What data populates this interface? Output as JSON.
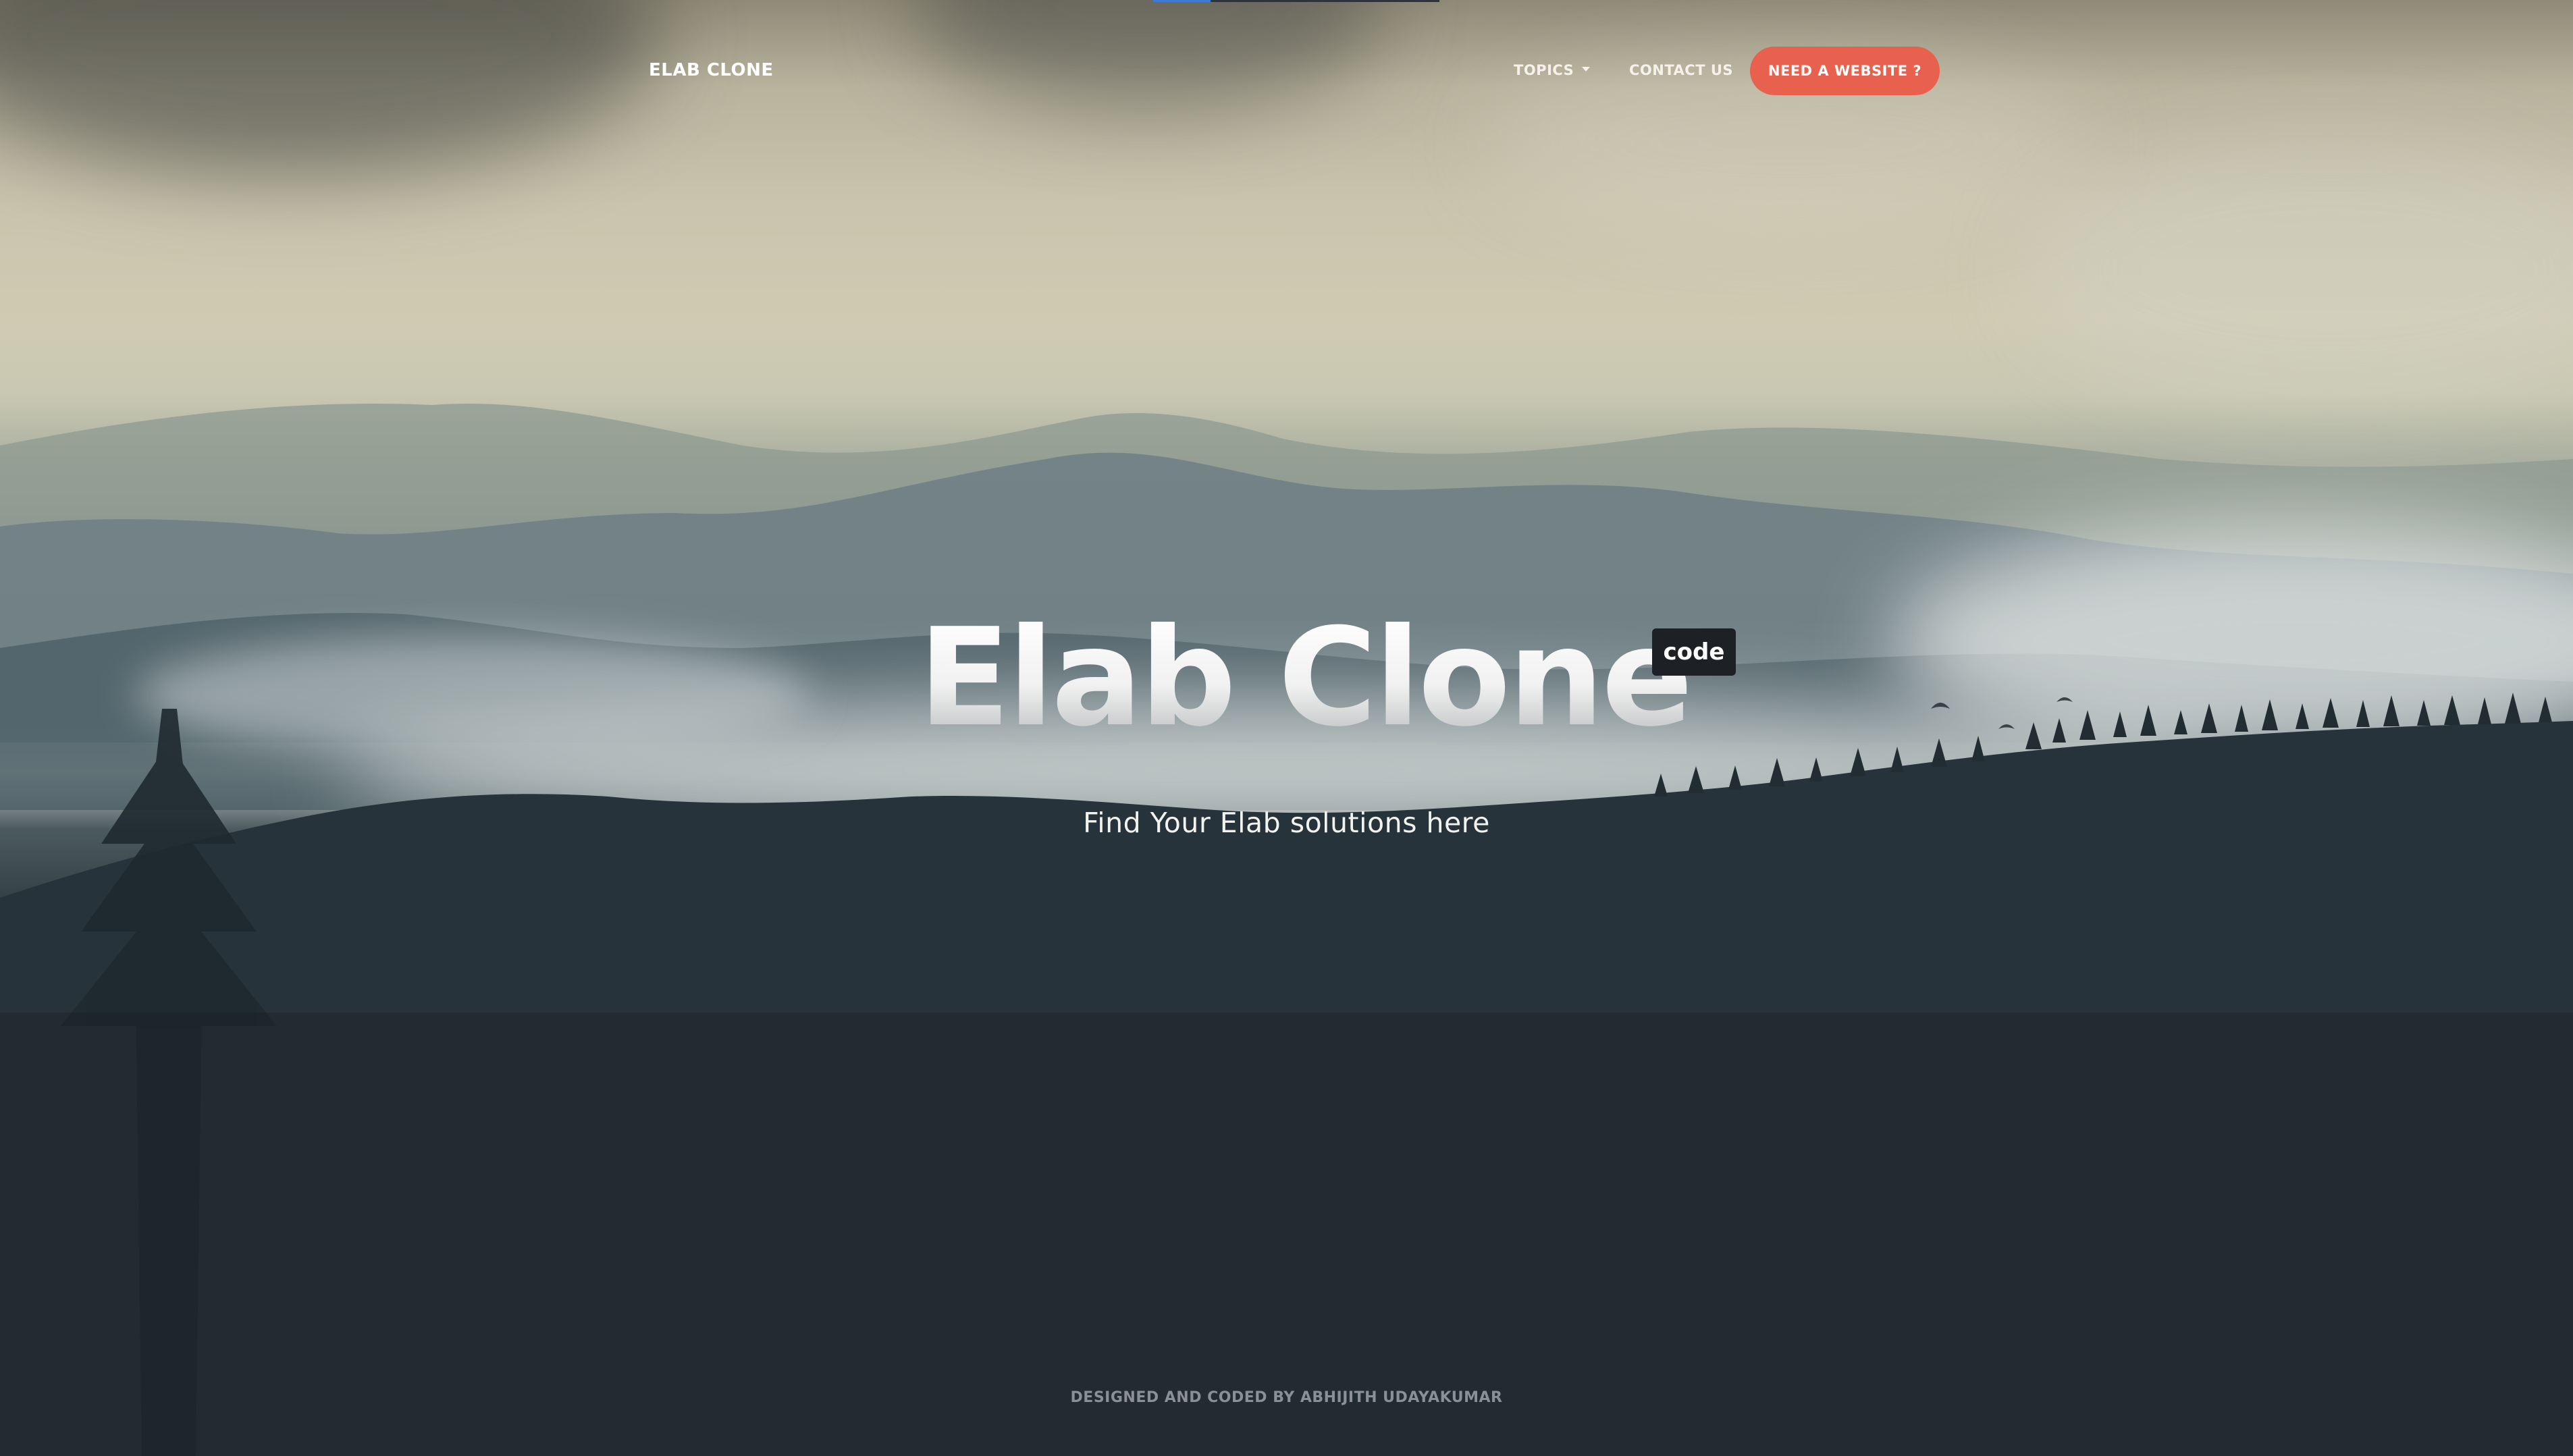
{
  "header": {
    "brand": "ELAB CLONE",
    "nav": {
      "topics_label": "TOPICS",
      "contact_label": "CONTACT US",
      "cta_label": "NEED A WEBSITE ?"
    },
    "scroll_progress": 0.2
  },
  "hero": {
    "title": "Elab Clone",
    "badge": "code",
    "subtitle": "Find Your Elab solutions here"
  },
  "footer": {
    "credit": "DESIGNED AND CODED BY ABHIJITH UDAYAKUMAR"
  },
  "colors": {
    "cta": "#e8614e",
    "badge_bg": "#1d2125",
    "progress_fill": "#3b7bd6"
  },
  "icons": {
    "topics_caret": "chevron-down-icon"
  }
}
